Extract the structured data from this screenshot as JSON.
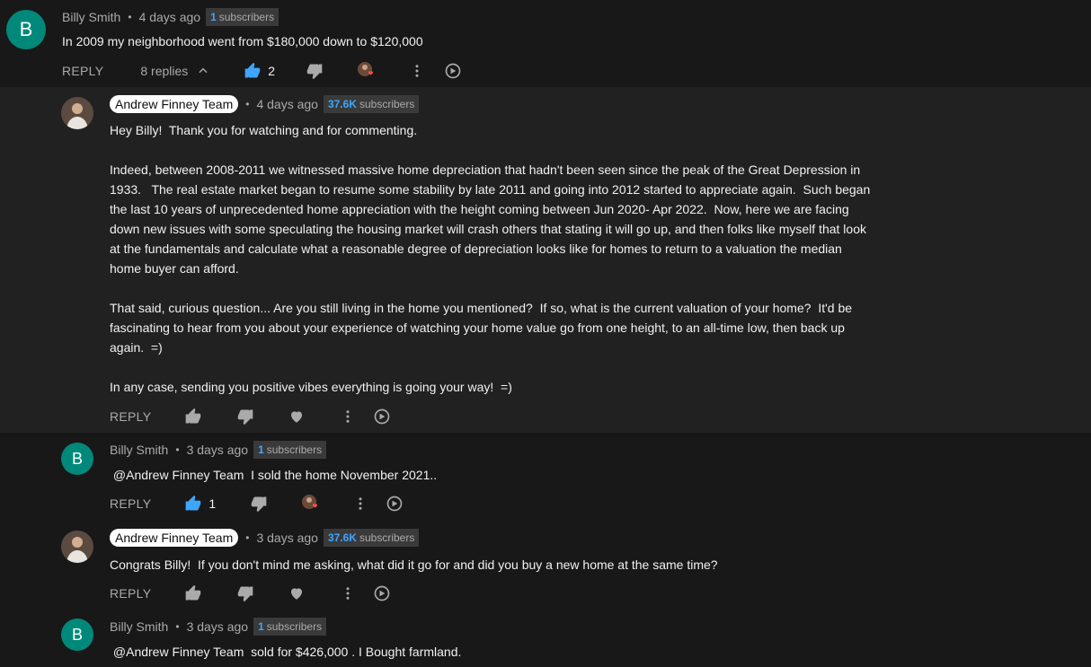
{
  "colors": {
    "background": "#181818",
    "highlight_row": "#212121",
    "like_active": "#3ea6ff",
    "avatar_letter_bg": "#00897b",
    "heart": "#ff4e45"
  },
  "labels": {
    "reply": "REPLY",
    "separator": "•",
    "subscribers_word": "subscribers"
  },
  "comments": [
    {
      "author": "Billy Smith",
      "avatar_letter": "B",
      "time": "4 days ago",
      "subscriber_count": "1",
      "text": "In 2009 my neighborhood went from $180,000 down to $120,000",
      "replies_label": "8 replies",
      "likes": "2",
      "hearted": true
    },
    {
      "author": "Andrew Finney Team",
      "time": "4 days ago",
      "subscriber_count": "37.6K",
      "text": "Hey Billy!  Thank you for watching and for commenting.\n\nIndeed, between 2008-2011 we witnessed massive home depreciation that hadn't been seen since the peak of the Great Depression in\n1933.   The real estate market began to resume some stability by late 2011 and going into 2012 started to appreciate again.  Such began\nthe last 10 years of unprecedented home appreciation with the height coming between Jun 2020- Apr 2022.  Now, here we are facing\ndown new issues with some speculating the housing market will crash others that stating it will go up, and then folks like myself that look\nat the fundamentals and calculate what a reasonable degree of depreciation looks like for homes to return to a valuation the median\nhome buyer can afford.\n\nThat said, curious question... Are you still living in the home you mentioned?  If so, what is the current valuation of your home?  It'd be\nfascinating to hear from you about your experience of watching your home value go from one height, to an all-time low, then back up\nagain.  =)\n\nIn any case, sending you positive vibes everything is going your way!  =)"
    },
    {
      "author": "Billy Smith",
      "avatar_letter": "B",
      "time": "3 days ago",
      "subscriber_count": "1",
      "text": " @Andrew Finney Team  I sold the home November 2021..",
      "likes": "1",
      "hearted": true
    },
    {
      "author": "Andrew Finney Team",
      "time": "3 days ago",
      "subscriber_count": "37.6K",
      "text": "Congrats Billy!  If you don't mind me asking, what did it go for and did you buy a new home at the same time?"
    },
    {
      "author": "Billy Smith",
      "avatar_letter": "B",
      "time": "3 days ago",
      "subscriber_count": "1",
      "text": " @Andrew Finney Team  sold for $426,000 . I Bought farmland."
    }
  ]
}
